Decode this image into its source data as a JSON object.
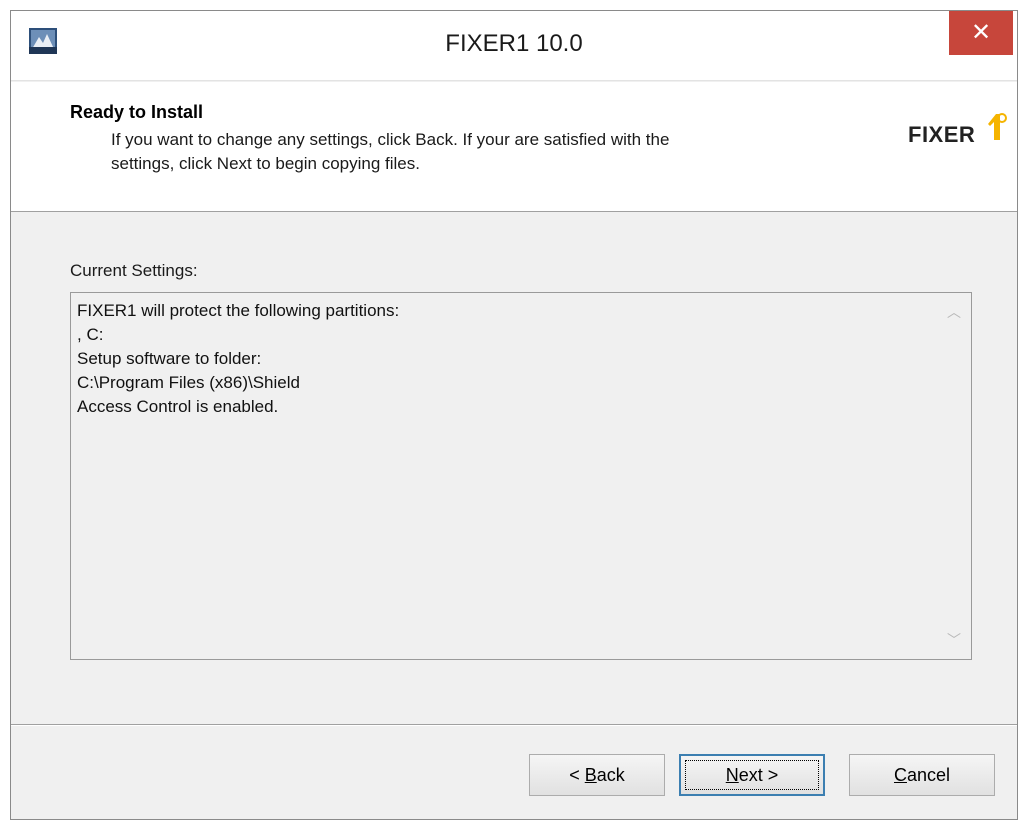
{
  "window": {
    "title": "FIXER1 10.0",
    "close_glyph": "✕",
    "app_icon": "installer-icon"
  },
  "header": {
    "title": "Ready to Install",
    "description_line1": "If you want to change any settings, click Back. If your are satisfied with the",
    "description_line2": "settings, click Next to begin copying files.",
    "logo_text": "FIXER",
    "logo_mark": "number-one-badge-icon"
  },
  "settings": {
    "label": "Current Settings:",
    "lines": [
      "FIXER1 will protect the following partitions:",
      ", C:",
      "Setup software to folder:",
      "C:\\Program Files (x86)\\Shield",
      "Access Control is enabled."
    ],
    "scroll_up_glyph": "︿",
    "scroll_down_glyph": "﹀"
  },
  "buttons": {
    "back": {
      "prefix": "< ",
      "mnemonic": "B",
      "rest": "ack"
    },
    "next": {
      "mnemonic": "N",
      "rest": "ext >"
    },
    "cancel": {
      "mnemonic": "C",
      "rest": "ancel"
    }
  },
  "colors": {
    "close_button": "#c7463b",
    "logo_accent": "#f5b400",
    "focus_border": "#3c7fb1"
  }
}
